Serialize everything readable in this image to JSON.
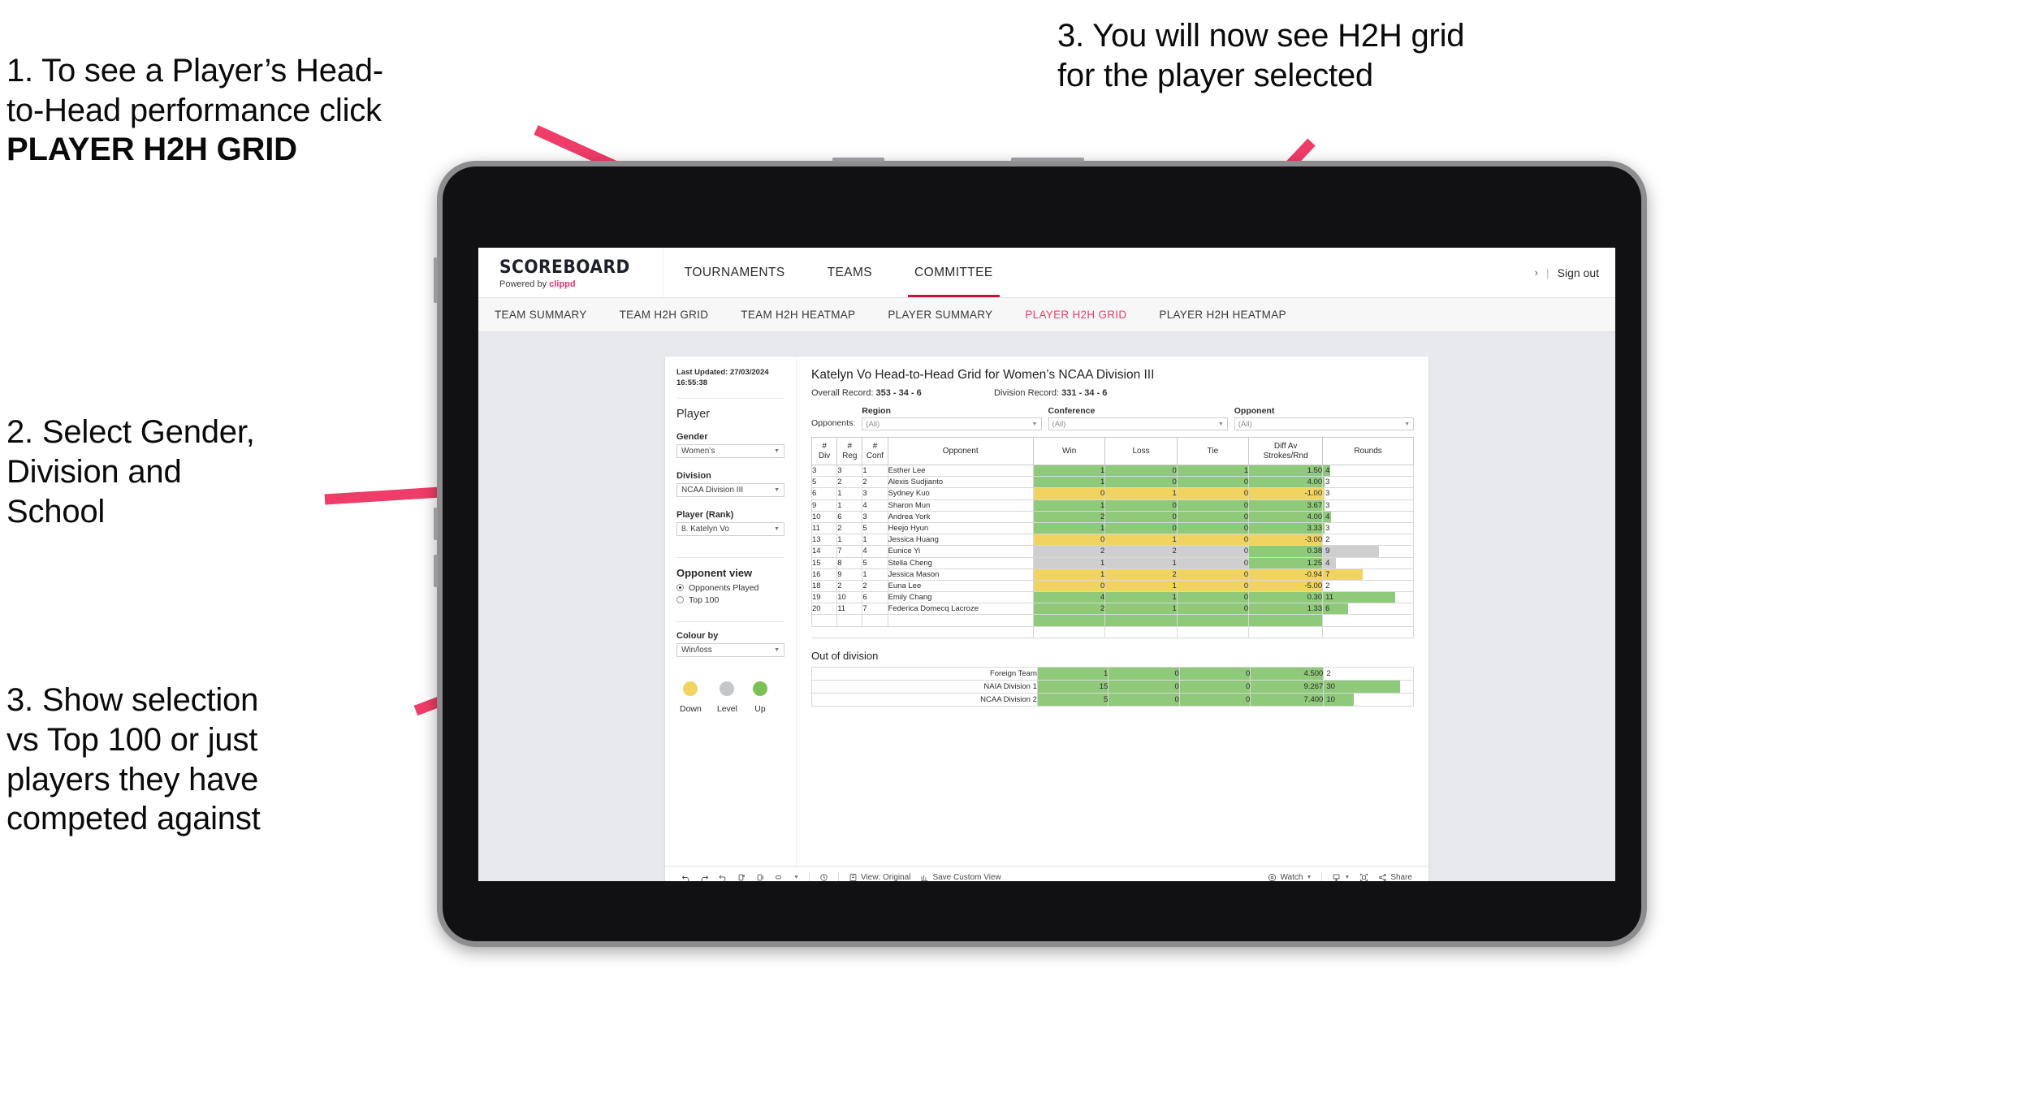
{
  "annotations": [
    {
      "id": "a1",
      "line1": "1. To see a Player’s Head-",
      "line2": "to-Head performance click",
      "bold": "PLAYER H2H GRID"
    },
    {
      "id": "a2",
      "text": "2. Select Gender,\nDivision and\nSchool"
    },
    {
      "id": "a3",
      "text": "3. Show selection\nvs Top 100 or just\nplayers they have\ncompeted against"
    },
    {
      "id": "a4",
      "text": "3. You will now see H2H grid\nfor the player selected"
    }
  ],
  "colors": {
    "accent_pink": "#ef3c68",
    "arrow_pink": "#ef3c68",
    "brand_red": "#c8143c",
    "green": "#8fc97a",
    "yellow": "#f0d45f",
    "grey": "#cfcfcf"
  },
  "app": {
    "brand": {
      "title": "SCOREBOARD",
      "powered_prefix": "Powered by ",
      "powered_name": "clippd"
    },
    "topnav": [
      {
        "label": "TOURNAMENTS",
        "active": false
      },
      {
        "label": "TEAMS",
        "active": false
      },
      {
        "label": "COMMITTEE",
        "active": true
      }
    ],
    "topbar_right": {
      "chevron": "›",
      "separator": "|",
      "signout": "Sign out"
    },
    "subnav": [
      {
        "label": "TEAM SUMMARY",
        "active": false
      },
      {
        "label": "TEAM H2H GRID",
        "active": false
      },
      {
        "label": "TEAM H2H HEATMAP",
        "active": false
      },
      {
        "label": "PLAYER SUMMARY",
        "active": false
      },
      {
        "label": "PLAYER H2H GRID",
        "active": true
      },
      {
        "label": "PLAYER H2H HEATMAP",
        "active": false
      }
    ]
  },
  "sidebar": {
    "last_updated": "Last Updated: 27/03/2024 16:55:38",
    "section_player": "Player",
    "gender": {
      "label": "Gender",
      "value": "Women’s"
    },
    "division": {
      "label": "Division",
      "value": "NCAA Division III"
    },
    "player_rank": {
      "label": "Player (Rank)",
      "value": "8. Katelyn Vo"
    },
    "opponent_view": {
      "title": "Opponent view",
      "options": [
        {
          "label": "Opponents Played",
          "selected": true
        },
        {
          "label": "Top 100",
          "selected": false
        }
      ]
    },
    "colour_by": {
      "label": "Colour by",
      "value": "Win/loss"
    },
    "legend": [
      {
        "label": "Down",
        "color": "#f0d45f"
      },
      {
        "label": "Level",
        "color": "#c4c6c8"
      },
      {
        "label": "Up",
        "color": "#7cc156"
      }
    ]
  },
  "main": {
    "title": "Katelyn Vo Head-to-Head Grid for Women’s NCAA Division III",
    "overall_record_label": "Overall Record:",
    "overall_record_value": "353 - 34 - 6",
    "division_record_label": "Division Record:",
    "division_record_value": "331 - 34 - 6",
    "filters_label": "Opponents:",
    "filters": [
      {
        "label": "Region",
        "value": "(All)"
      },
      {
        "label": "Conference",
        "value": "(All)"
      },
      {
        "label": "Opponent",
        "value": "(All)"
      }
    ],
    "out_of_division_title": "Out of division"
  },
  "chart_data": {
    "type": "table",
    "title": "Katelyn Vo Head-to-Head Grid for Women’s NCAA Division III",
    "columns": [
      "# Div",
      "# Reg",
      "# Conf",
      "Opponent",
      "Win",
      "Loss",
      "Tie",
      "Diff Av Strokes/Rnd",
      "Rounds"
    ],
    "column_headers_multiline": [
      {
        "top": "#",
        "bottom": "Div"
      },
      {
        "top": "#",
        "bottom": "Reg"
      },
      {
        "top": "#",
        "bottom": "Conf"
      },
      {
        "top": "",
        "bottom": "Opponent"
      },
      {
        "top": "",
        "bottom": "Win"
      },
      {
        "top": "",
        "bottom": "Loss"
      },
      {
        "top": "",
        "bottom": "Tie"
      },
      {
        "top": "Diff Av",
        "bottom": "Strokes/Rnd"
      },
      {
        "top": "",
        "bottom": "Rounds"
      }
    ],
    "rows": [
      {
        "div": "3",
        "reg": "3",
        "conf": "1",
        "opponent": "Esther Lee",
        "win": "1",
        "loss": "0",
        "tie": "1",
        "diff": "1.50",
        "rounds": "4",
        "rounds_pct": 8,
        "color": "green"
      },
      {
        "div": "5",
        "reg": "2",
        "conf": "2",
        "opponent": "Alexis Sudjianto",
        "win": "1",
        "loss": "0",
        "tie": "0",
        "diff": "4.00",
        "rounds": "3",
        "rounds_pct": 2,
        "color": "green"
      },
      {
        "div": "6",
        "reg": "1",
        "conf": "3",
        "opponent": "Sydney Kuo",
        "win": "0",
        "loss": "1",
        "tie": "0",
        "diff": "-1.00",
        "rounds": "3",
        "rounds_pct": 2,
        "color": "yellow"
      },
      {
        "div": "9",
        "reg": "1",
        "conf": "4",
        "opponent": "Sharon Mun",
        "win": "1",
        "loss": "0",
        "tie": "0",
        "diff": "3.67",
        "rounds": "3",
        "rounds_pct": 2,
        "color": "green"
      },
      {
        "div": "10",
        "reg": "6",
        "conf": "3",
        "opponent": "Andrea York",
        "win": "2",
        "loss": "0",
        "tie": "0",
        "diff": "4.00",
        "rounds": "4",
        "rounds_pct": 9,
        "color": "green"
      },
      {
        "div": "11",
        "reg": "2",
        "conf": "5",
        "opponent": "Heejo Hyun",
        "win": "1",
        "loss": "0",
        "tie": "0",
        "diff": "3.33",
        "rounds": "3",
        "rounds_pct": 2,
        "color": "green"
      },
      {
        "div": "13",
        "reg": "1",
        "conf": "1",
        "opponent": "Jessica Huang",
        "win": "0",
        "loss": "1",
        "tie": "0",
        "diff": "-3.00",
        "rounds": "2",
        "rounds_pct": 0,
        "color": "yellow"
      },
      {
        "div": "14",
        "reg": "7",
        "conf": "4",
        "opponent": "Eunice Yi",
        "win": "2",
        "loss": "2",
        "tie": "0",
        "diff": "0.38",
        "rounds": "9",
        "rounds_pct": 62,
        "color": "grey"
      },
      {
        "div": "15",
        "reg": "8",
        "conf": "5",
        "opponent": "Stella Cheng",
        "win": "1",
        "loss": "1",
        "tie": "0",
        "diff": "1.25",
        "rounds": "4",
        "rounds_pct": 14,
        "color": "grey"
      },
      {
        "div": "16",
        "reg": "9",
        "conf": "1",
        "opponent": "Jessica Mason",
        "win": "1",
        "loss": "2",
        "tie": "0",
        "diff": "-0.94",
        "rounds": "7",
        "rounds_pct": 44,
        "color": "yellow"
      },
      {
        "div": "18",
        "reg": "2",
        "conf": "2",
        "opponent": "Euna Lee",
        "win": "0",
        "loss": "1",
        "tie": "0",
        "diff": "-5.00",
        "rounds": "2",
        "rounds_pct": 0,
        "color": "yellow"
      },
      {
        "div": "19",
        "reg": "10",
        "conf": "6",
        "opponent": "Emily Chang",
        "win": "4",
        "loss": "1",
        "tie": "0",
        "diff": "0.30",
        "rounds": "11",
        "rounds_pct": 80,
        "color": "green"
      },
      {
        "div": "20",
        "reg": "11",
        "conf": "7",
        "opponent": "Federica Domecq Lacroze",
        "win": "2",
        "loss": "1",
        "tie": "0",
        "diff": "1.33",
        "rounds": "6",
        "rounds_pct": 28,
        "color": "green"
      }
    ],
    "out_of_division": {
      "title": "Out of division",
      "rows": [
        {
          "label": "Foreign Team",
          "win": "1",
          "loss": "0",
          "tie": "0",
          "diff": "4.500",
          "rounds": "2",
          "rounds_pct": 0,
          "color": "green"
        },
        {
          "label": "NAIA Division 1",
          "win": "15",
          "loss": "0",
          "tie": "0",
          "diff": "9.267",
          "rounds": "30",
          "rounds_pct": 85,
          "color": "green"
        },
        {
          "label": "NCAA Division 2",
          "win": "5",
          "loss": "0",
          "tie": "0",
          "diff": "7.400",
          "rounds": "10",
          "rounds_pct": 33,
          "color": "green"
        }
      ]
    }
  },
  "toolbar": {
    "items": [
      {
        "name": "undo-icon",
        "label": ""
      },
      {
        "name": "redo-icon",
        "label": ""
      },
      {
        "name": "revert-icon",
        "label": ""
      },
      {
        "name": "refresh-data-icon",
        "label": ""
      },
      {
        "name": "pause-updates-icon",
        "label": ""
      },
      {
        "name": "highlight-icon",
        "label": ""
      },
      {
        "name": "chevron-down-icon",
        "label": ""
      },
      {
        "name": "history-icon",
        "label": ""
      },
      {
        "name": "view-original-icon",
        "label": "View: Original"
      },
      {
        "name": "save-custom-view-icon",
        "label": "Save Custom View"
      },
      {
        "name": "watch-icon",
        "label": "Watch"
      },
      {
        "name": "download-icon",
        "label": ""
      },
      {
        "name": "fullscreen-icon",
        "label": ""
      },
      {
        "name": "share-icon",
        "label": "Share"
      }
    ],
    "view_original": "View: Original",
    "save_custom_view": "Save Custom View",
    "watch": "Watch",
    "share": "Share"
  }
}
